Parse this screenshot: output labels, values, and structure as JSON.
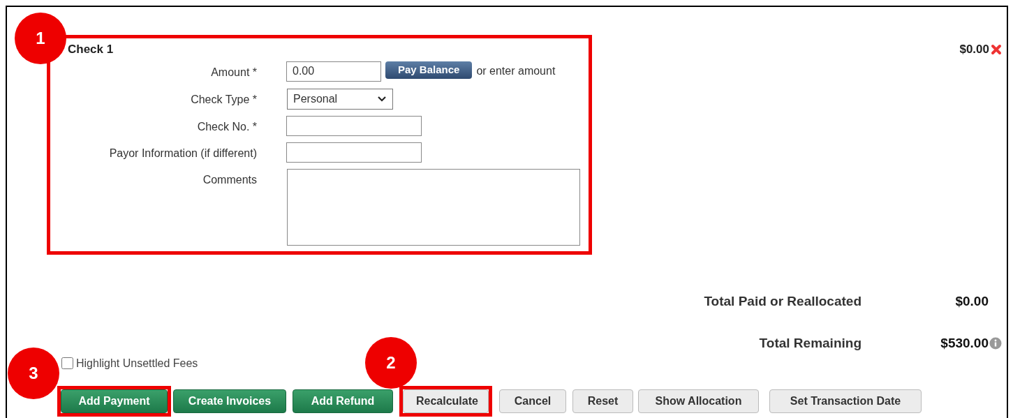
{
  "check": {
    "title": "Check 1",
    "amount_display": "$0.00",
    "fields": [
      {
        "kind": "amount",
        "label": "Amount *",
        "value": "0.00",
        "button": "Pay Balance",
        "hint": "or enter amount"
      },
      {
        "kind": "select",
        "label": "Check Type *",
        "value": "Personal"
      },
      {
        "kind": "text",
        "label": "Check No. *"
      },
      {
        "kind": "text",
        "label": "Payor Information (if different)"
      },
      {
        "kind": "textarea",
        "label": "Comments"
      }
    ]
  },
  "totals": [
    {
      "label": "Total Paid or Reallocated",
      "value": "$0.00",
      "info": false
    },
    {
      "label": "Total Remaining",
      "value": "$530.00",
      "info": true
    }
  ],
  "highlight_unsettled_fees": {
    "label": "Highlight Unsettled Fees",
    "checked": false
  },
  "buttons": [
    {
      "label": "Add Payment",
      "kind": "green",
      "highlighted": true
    },
    {
      "label": "Create Invoices",
      "kind": "green",
      "highlighted": false
    },
    {
      "label": "Add Refund",
      "kind": "green",
      "highlighted": false
    },
    {
      "label": "Recalculate",
      "kind": "gray",
      "highlighted": true
    },
    {
      "label": "Cancel",
      "kind": "gray",
      "highlighted": false
    },
    {
      "label": "Reset",
      "kind": "gray",
      "highlighted": false
    },
    {
      "label": "Show Allocation",
      "kind": "gray",
      "highlighted": false
    },
    {
      "label": "Set Transaction Date",
      "kind": "gray",
      "highlighted": false
    }
  ],
  "callouts": [
    "1",
    "2",
    "3"
  ]
}
